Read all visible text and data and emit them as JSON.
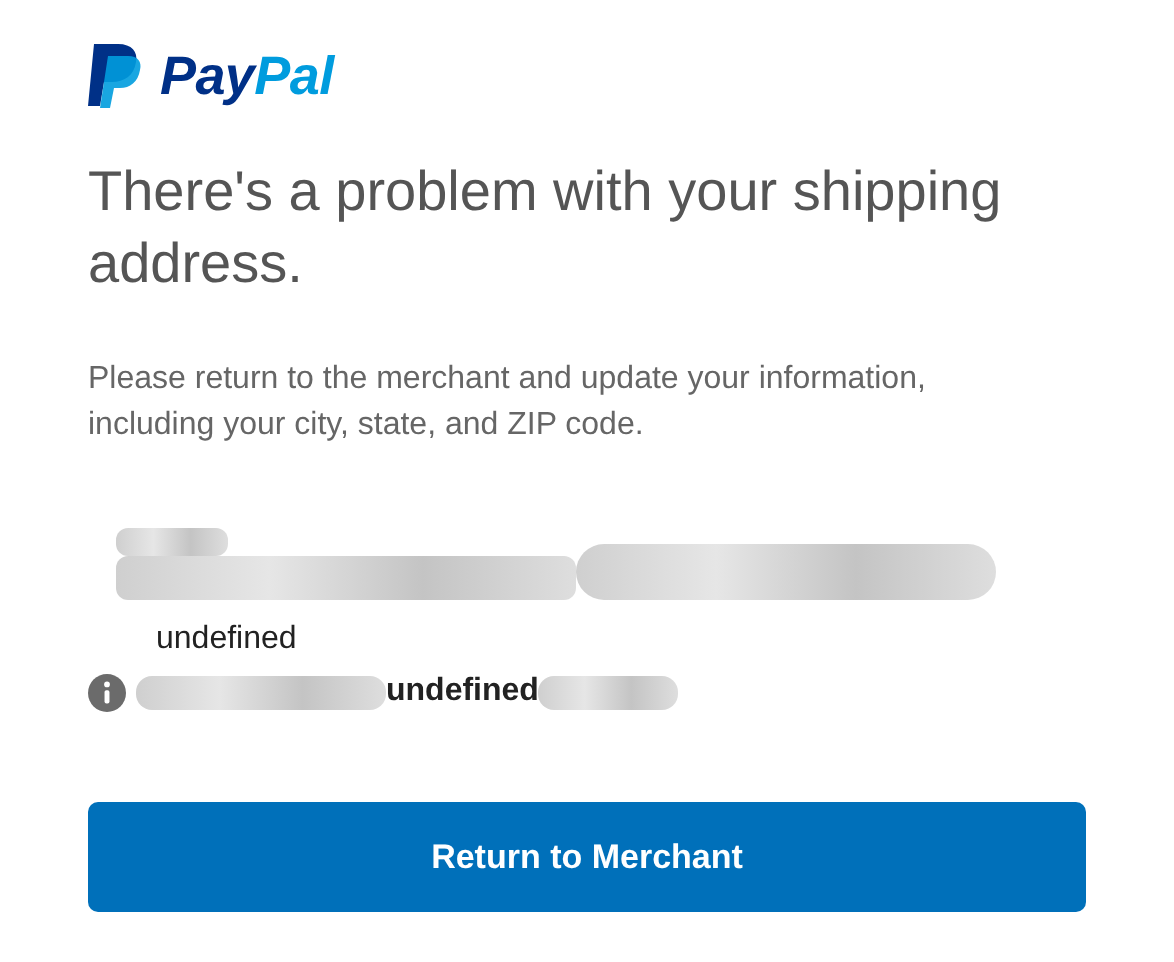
{
  "logo": {
    "parts": [
      "Pay",
      "Pal"
    ]
  },
  "heading": "There's a problem with your shipping address.",
  "message": "Please return to the merchant and update your information, including your city, state, and ZIP code.",
  "address": {
    "line": "undefined",
    "notice": "undefined"
  },
  "button": "Return to Merchant"
}
